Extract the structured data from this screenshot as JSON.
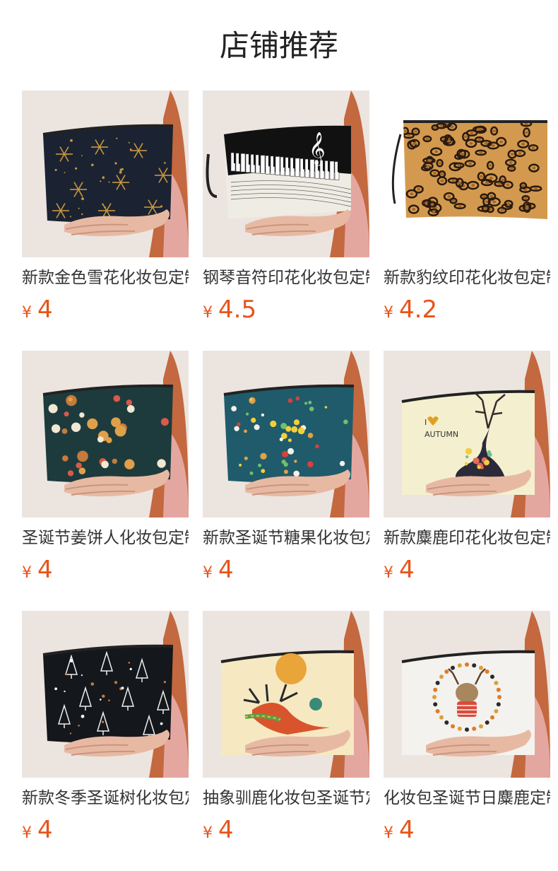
{
  "header": {
    "title": "店铺推荐"
  },
  "products": [
    {
      "title": "新款金色雪花化妆包定制",
      "currency": "¥",
      "price": "4",
      "pattern": "snowflake-gold",
      "icon": "product-image-snowflake-bag"
    },
    {
      "title": "钢琴音符印花化妆包定制",
      "currency": "¥",
      "price": "4.5",
      "pattern": "piano-notes",
      "icon": "product-image-piano-bag"
    },
    {
      "title": "新款豹纹印花化妆包定制",
      "currency": "¥",
      "price": "4.2",
      "pattern": "leopard",
      "icon": "product-image-leopard-bag"
    },
    {
      "title": "圣诞节姜饼人化妆包定制",
      "currency": "¥",
      "price": "4",
      "pattern": "gingerbread",
      "icon": "product-image-gingerbread-bag"
    },
    {
      "title": "新款圣诞节糖果化妆包定制",
      "currency": "¥",
      "price": "4",
      "pattern": "candy",
      "icon": "product-image-candy-bag"
    },
    {
      "title": "新款麋鹿印花化妆包定制",
      "currency": "¥",
      "price": "4",
      "pattern": "autumn-deer",
      "icon": "product-image-deer-bag"
    },
    {
      "title": "新款冬季圣诞树化妆包定制",
      "currency": "¥",
      "price": "4",
      "pattern": "xmas-trees",
      "icon": "product-image-tree-bag"
    },
    {
      "title": "抽象驯鹿化妆包圣诞节定制",
      "currency": "¥",
      "price": "4",
      "pattern": "abstract-reindeer",
      "icon": "product-image-reindeer-bag"
    },
    {
      "title": "化妆包圣诞节日麋鹿定制",
      "currency": "¥",
      "price": "4",
      "pattern": "wreath-deer",
      "icon": "product-image-wreath-deer-bag"
    }
  ],
  "colors": {
    "price": "#e8541a",
    "title": "#333333",
    "header": "#222222"
  }
}
